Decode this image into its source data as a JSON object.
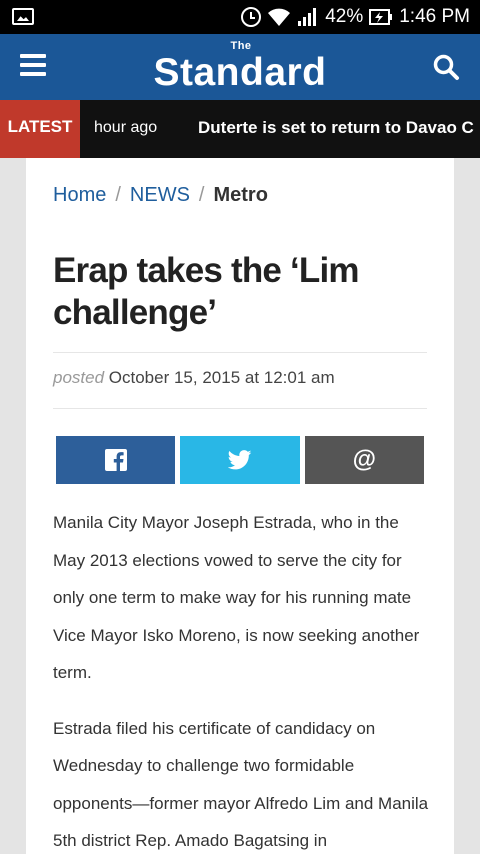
{
  "status_bar": {
    "battery": "42%",
    "time": "1:46 PM"
  },
  "header": {
    "logo_small": "The",
    "logo_main": "Standard"
  },
  "ticker": {
    "label": "LATEST",
    "time": "hour ago",
    "headline": "Duterte is set to return to Davao C"
  },
  "breadcrumb": {
    "home": "Home",
    "section": "NEWS",
    "current": "Metro",
    "separator": "/"
  },
  "article": {
    "title": "Erap takes the ‘Lim challenge’",
    "posted_label": "posted",
    "posted_date": "October 15, 2015 at 12:01 am",
    "paragraphs": [
      "Manila City Mayor Joseph Estrada, who in the  May 2013 elections vowed to serve the city for only one term to make  way for his running mate Vice Mayor Isko Moreno, is now seeking another term.",
      "Estrada filed his certificate of candidacy on Wednesday to challenge two formidable opponents—former mayor Alfredo Lim and Manila 5th district Rep. Amado Bagatsing in"
    ]
  },
  "share": {
    "email_symbol": "@"
  },
  "colors": {
    "header_bg": "#1b5797",
    "latest_bg": "#c0392b",
    "facebook": "#2d5f9a",
    "twitter": "#29b7e6",
    "email": "#555555",
    "link": "#1f5e9d"
  }
}
